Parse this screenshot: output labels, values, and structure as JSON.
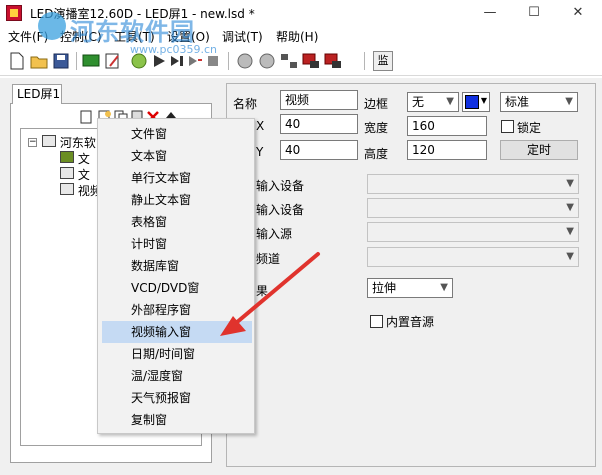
{
  "window": {
    "title": "LED演播室12.60D - LED屏1 - new.lsd *",
    "minimize": "—",
    "maximize": "☐",
    "close": "✕"
  },
  "watermark": {
    "text": "河东软件园",
    "url": "www.pc0359.cn"
  },
  "menubar": {
    "items": [
      "文件(F)",
      "控制(C)",
      "工具(T)",
      "设置(O)",
      "调试(T)",
      "帮助(H)"
    ]
  },
  "toolbar": {
    "text_button": "监"
  },
  "left_panel": {
    "tab": "LED屏1",
    "tree": {
      "root": "河东软",
      "children": [
        "文",
        "文",
        "视频"
      ]
    }
  },
  "context_menu": {
    "items": [
      "文件窗",
      "文本窗",
      "单行文本窗",
      "静止文本窗",
      "表格窗",
      "计时窗",
      "数据库窗",
      "VCD/DVD窗",
      "外部程序窗",
      "视频输入窗",
      "日期/时间窗",
      "温/湿度窗",
      "天气预报窗",
      "复制窗"
    ],
    "highlighted_index": 9
  },
  "props": {
    "name_label": "名称",
    "name_value": "视频",
    "x_label": "X",
    "x_value": "40",
    "y_label": "Y",
    "y_value": "40",
    "border_label": "边框",
    "border_value": "无",
    "border_color": "#1030e0",
    "width_label": "宽度",
    "width_value": "160",
    "height_label": "高度",
    "height_value": "120",
    "style_value": "标准",
    "lock_label": "锁定",
    "lock_checked": false,
    "timer_button": "定时",
    "device_label_1": "输入设备",
    "device_label_2": "输入设备",
    "source_label": "输入源",
    "channel_label": "频道",
    "effect_label": "果",
    "effect_value": "拉伸",
    "builtin_audio_label": "内置音源",
    "builtin_audio_checked": false
  },
  "colors": {
    "highlight": "#c5daf3",
    "arrow": "#e0332d"
  }
}
